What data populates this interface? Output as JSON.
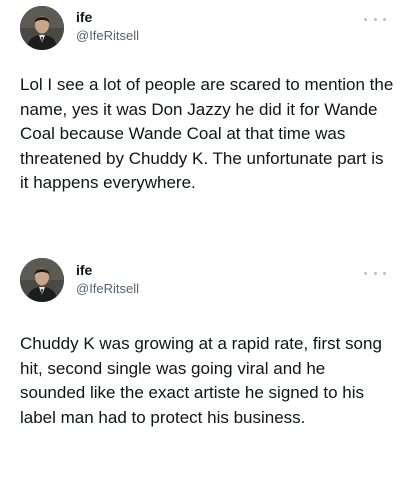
{
  "tweets": [
    {
      "author_name": "ife",
      "author_handle": "@IfeRitsell",
      "text": "Lol I see a lot of people are scared to mention the name, yes it was Don Jazzy he did it for Wande Coal because Wande Coal at that time was threatened by Chuddy K. The unfortunate part is it happens everywhere.",
      "more_icon": "more-horizontal-icon"
    },
    {
      "author_name": "ife",
      "author_handle": "@IfeRitsell",
      "text": "Chuddy K was growing at a rapid rate, first song hit, second single was going viral and he sounded like the exact artiste he signed to his label man had to protect his business.",
      "more_icon": "more-horizontal-icon"
    }
  ],
  "colors": {
    "text": "#0f1419",
    "secondary_text": "#536471",
    "more_dots": "#b9c1c7",
    "background": "#ffffff"
  }
}
